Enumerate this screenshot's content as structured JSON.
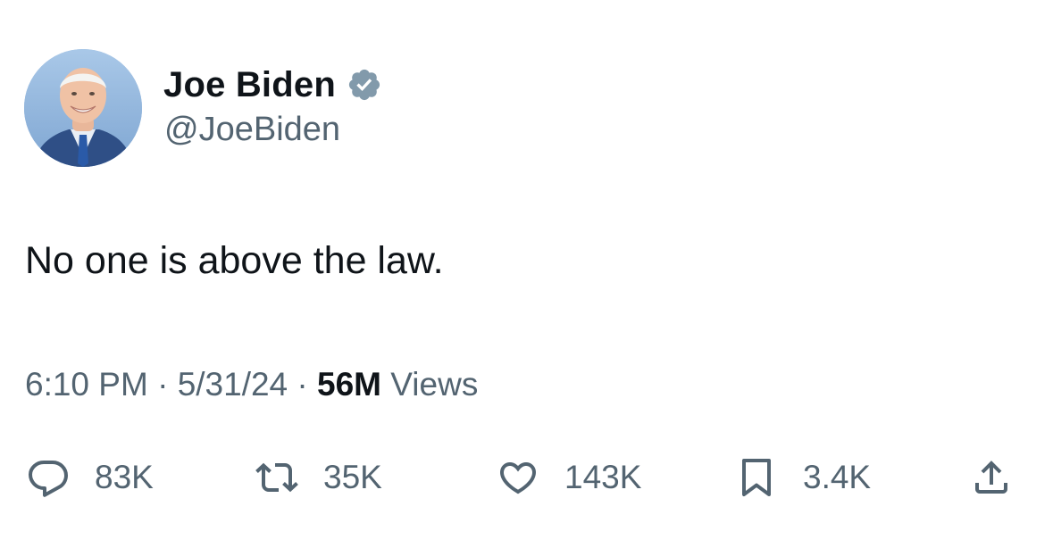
{
  "author": {
    "display_name": "Joe Biden",
    "handle": "@JoeBiden",
    "verified": true,
    "avatar_icon": "profile-photo-avatar"
  },
  "tweet": {
    "text": "No one is above the law.",
    "time": "6:10 PM",
    "date": "5/31/24",
    "views_count": "56M",
    "views_label": "Views",
    "separator": "·"
  },
  "actions": {
    "reply_count": "83K",
    "repost_count": "35K",
    "like_count": "143K",
    "bookmark_count": "3.4K"
  },
  "icons": {
    "verified": "verified-badge-icon",
    "reply": "reply-icon",
    "repost": "repost-icon",
    "like": "heart-icon",
    "bookmark": "bookmark-icon",
    "share": "share-icon"
  },
  "colors": {
    "text_primary": "#0f1419",
    "text_secondary": "#536471",
    "verified_badge": "#829aab",
    "background": "#ffffff"
  }
}
